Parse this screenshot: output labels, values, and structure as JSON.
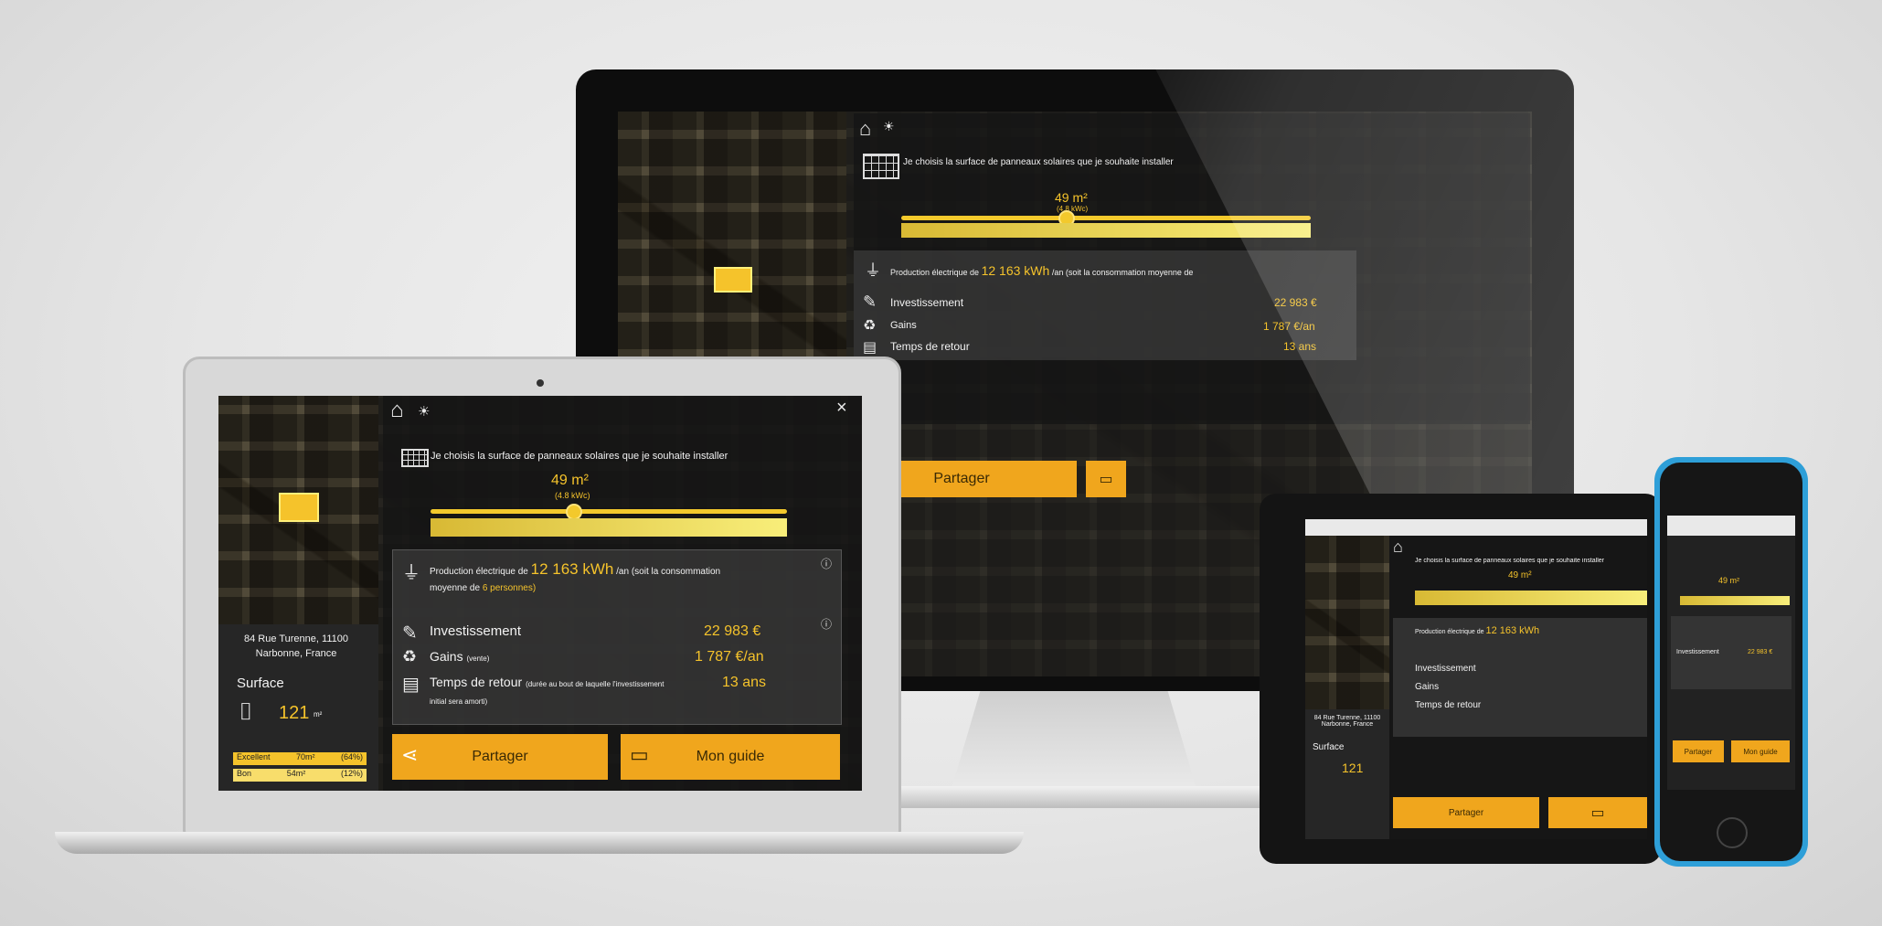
{
  "shared": {
    "solar_icon": "solar-panel-icon",
    "surface_prompt": "Je choisis la surface de panneaux solaires que je souhaite installer",
    "surface_value": "49 m²",
    "surface_kwc": "(4.8 kWc)",
    "production_prefix": "Production électrique de",
    "production_value": "12 163 kWh",
    "production_suffix": "/an (soit la consommation moyenne de",
    "production_persons": "6 personnes)",
    "invest_label": "Investissement",
    "invest_value": "22 983 €",
    "gains_label": "Gains",
    "gains_note": "(vente)",
    "gains_value": "1 787 €/an",
    "payback_label": "Temps de retour",
    "payback_note": "(durée au bout de laquelle l'investissement initial sera amorti)",
    "payback_value": "13 ans",
    "share_label": "Partager",
    "guide_label": "Mon guide",
    "address": "84 Rue Turenne, 11100 Narbonne, France",
    "surface_title": "Surface",
    "surface_area": "121",
    "surface_unit": "m²",
    "rating": [
      {
        "label": "Excellent",
        "area": "70m²",
        "pct": "(64%)"
      },
      {
        "label": "Bon",
        "area": "54m²",
        "pct": "(12%)"
      }
    ],
    "close": "×"
  },
  "colors": {
    "accent": "#f5c32b",
    "button": "#f0a61d",
    "panel": "#232323"
  }
}
